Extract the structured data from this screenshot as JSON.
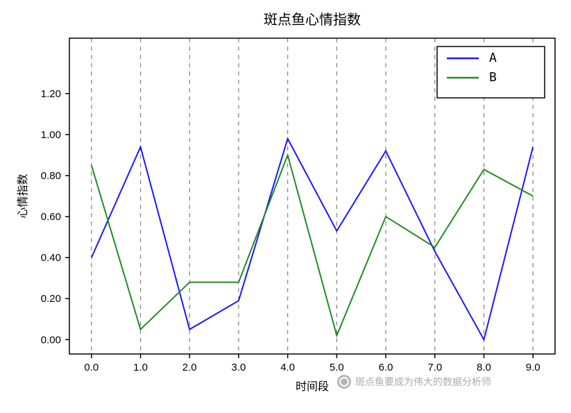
{
  "chart_data": {
    "type": "line",
    "title": "斑点鱼心情指数",
    "xlabel": "时间段",
    "ylabel": "心情指数",
    "x": [
      0.0,
      1.0,
      2.0,
      3.0,
      4.0,
      5.0,
      6.0,
      7.0,
      8.0,
      9.0
    ],
    "series": [
      {
        "name": "A",
        "color": "#1818ff",
        "values": [
          0.4,
          0.94,
          0.05,
          0.19,
          0.98,
          0.53,
          0.92,
          0.43,
          0.0,
          0.94
        ]
      },
      {
        "name": "B",
        "color": "#228b22",
        "values": [
          0.85,
          0.05,
          0.28,
          0.28,
          0.9,
          0.02,
          0.6,
          0.45,
          0.83,
          0.7
        ]
      }
    ],
    "xticks": [
      "0.0",
      "1.0",
      "2.0",
      "3.0",
      "4.0",
      "5.0",
      "6.0",
      "7.0",
      "8.0",
      "9.0"
    ],
    "yticks": [
      "0.00",
      "0.20",
      "0.40",
      "0.60",
      "0.80",
      "1.00",
      "1.20"
    ],
    "xlim": [
      -0.45,
      9.45
    ],
    "ylim": [
      -0.07,
      1.47
    ]
  },
  "legend": {
    "items": [
      {
        "label": "A",
        "color": "#1818ff"
      },
      {
        "label": "B",
        "color": "#228b22"
      }
    ]
  },
  "watermark": {
    "text": "斑点鱼要成为伟大的数据分析师"
  }
}
